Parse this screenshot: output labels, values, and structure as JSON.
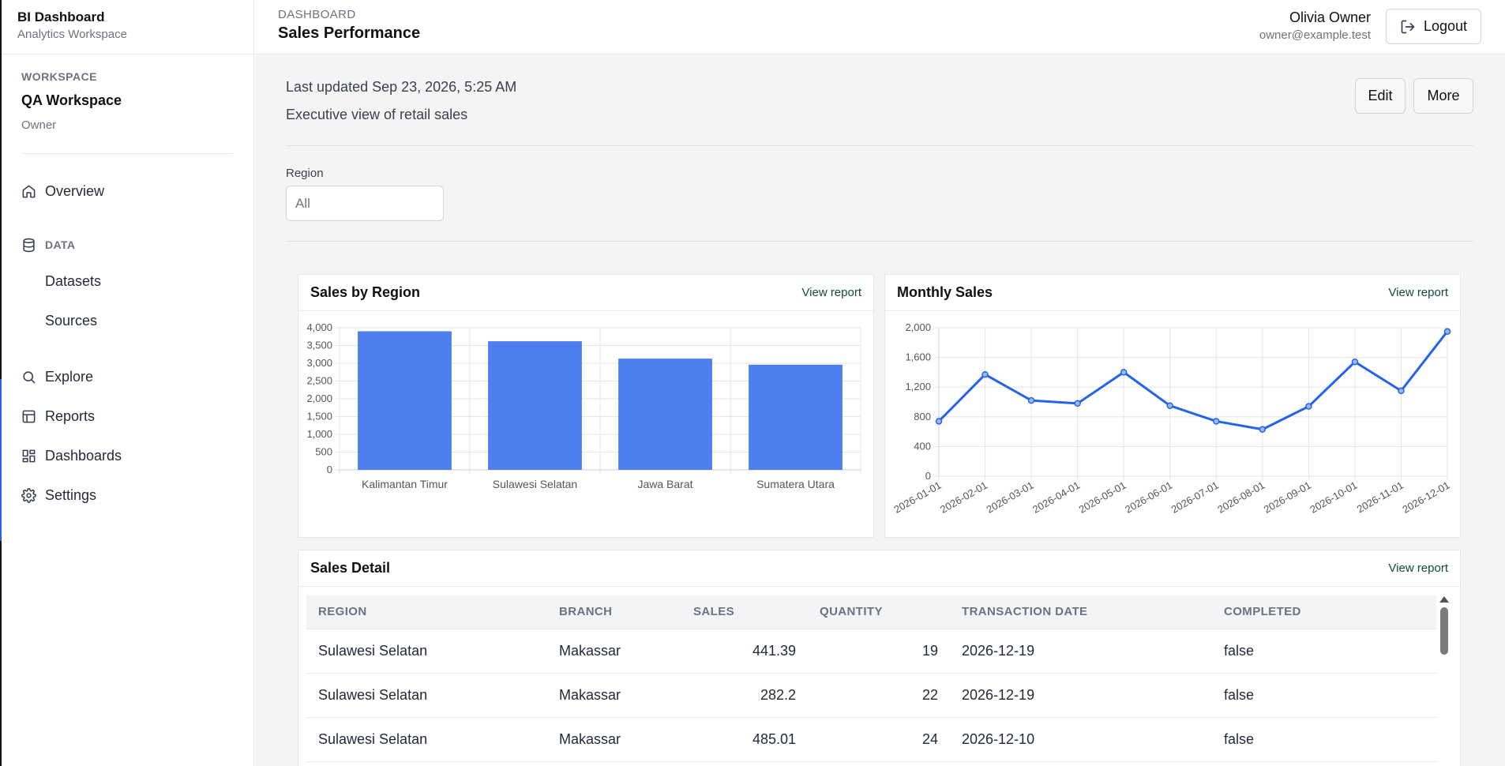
{
  "app": {
    "title": "BI Dashboard",
    "subtitle": "Analytics Workspace"
  },
  "workspace": {
    "label": "WORKSPACE",
    "name": "QA Workspace",
    "role": "Owner"
  },
  "nav": {
    "overview": "Overview",
    "data_header": "DATA",
    "datasets": "Datasets",
    "sources": "Sources",
    "explore": "Explore",
    "reports": "Reports",
    "dashboards": "Dashboards",
    "settings": "Settings"
  },
  "header": {
    "breadcrumb": "DASHBOARD",
    "title": "Sales Performance"
  },
  "user": {
    "name": "Olivia Owner",
    "email": "owner@example.test",
    "logout_label": "Logout"
  },
  "dashboard": {
    "last_updated": "Last updated Sep 23, 2026, 5:25 AM",
    "description": "Executive view of retail sales",
    "edit_label": "Edit",
    "more_label": "More"
  },
  "filter": {
    "label": "Region",
    "placeholder": "All"
  },
  "cards": {
    "sales_by_region": {
      "title": "Sales by Region",
      "link": "View report"
    },
    "monthly_sales": {
      "title": "Monthly Sales",
      "link": "View report"
    },
    "sales_detail": {
      "title": "Sales Detail",
      "link": "View report"
    }
  },
  "colors": {
    "accent": "#2563eb",
    "bar_fill": "#4f7fee",
    "link": "#0f4c3a"
  },
  "chart_data": [
    {
      "type": "bar",
      "title": "Sales by Region",
      "categories": [
        "Kalimantan Timur",
        "Sulawesi Selatan",
        "Jawa Barat",
        "Sumatera Utara"
      ],
      "values": [
        3900,
        3620,
        3130,
        2960
      ],
      "ylim": [
        0,
        4000
      ],
      "yticks": [
        0,
        500,
        1000,
        1500,
        2000,
        2500,
        3000,
        3500,
        4000
      ],
      "ytick_labels": [
        "0",
        "500",
        "1,000",
        "1,500",
        "2,000",
        "2,500",
        "3,000",
        "3,500",
        "4,000"
      ],
      "grid": true
    },
    {
      "type": "line",
      "title": "Monthly Sales",
      "x": [
        "2026-01-01",
        "2026-02-01",
        "2026-03-01",
        "2026-04-01",
        "2026-05-01",
        "2026-06-01",
        "2026-07-01",
        "2026-08-01",
        "2026-09-01",
        "2026-10-01",
        "2026-11-01",
        "2026-12-01"
      ],
      "values": [
        740,
        1370,
        1020,
        980,
        1400,
        950,
        740,
        630,
        940,
        1540,
        1150,
        1950
      ],
      "ylim": [
        0,
        2000
      ],
      "yticks": [
        0,
        400,
        800,
        1200,
        1600,
        2000
      ],
      "ytick_labels": [
        "0",
        "400",
        "800",
        "1,200",
        "1,600",
        "2,000"
      ],
      "grid": true
    }
  ],
  "table": {
    "columns": [
      "REGION",
      "BRANCH",
      "SALES",
      "QUANTITY",
      "TRANSACTION DATE",
      "COMPLETED"
    ],
    "rows": [
      [
        "Sulawesi Selatan",
        "Makassar",
        "441.39",
        "19",
        "2026-12-19",
        "false"
      ],
      [
        "Sulawesi Selatan",
        "Makassar",
        "282.2",
        "22",
        "2026-12-19",
        "false"
      ],
      [
        "Sulawesi Selatan",
        "Makassar",
        "485.01",
        "24",
        "2026-12-10",
        "false"
      ]
    ]
  }
}
